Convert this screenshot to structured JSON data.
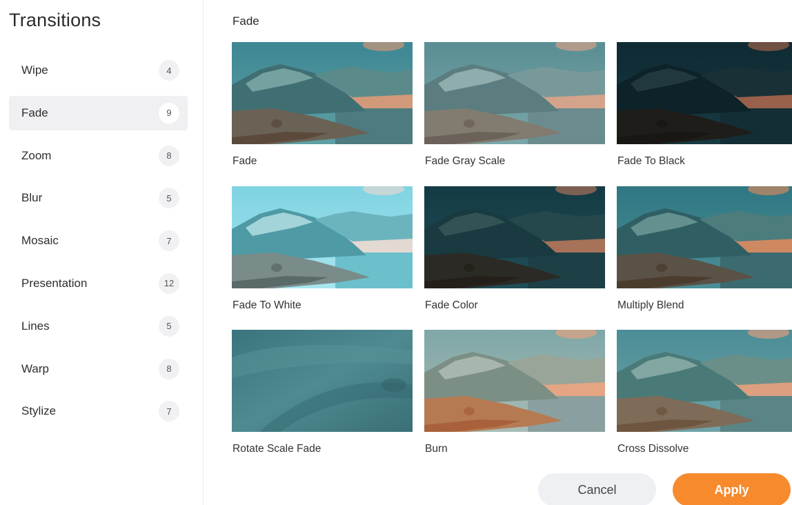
{
  "sidebar": {
    "title": "Transitions",
    "items": [
      {
        "label": "Wipe",
        "count": "4"
      },
      {
        "label": "Fade",
        "count": "9"
      },
      {
        "label": "Zoom",
        "count": "8"
      },
      {
        "label": "Blur",
        "count": "5"
      },
      {
        "label": "Mosaic",
        "count": "7"
      },
      {
        "label": "Presentation",
        "count": "12"
      },
      {
        "label": "Lines",
        "count": "5"
      },
      {
        "label": "Warp",
        "count": "8"
      },
      {
        "label": "Stylize",
        "count": "7"
      }
    ],
    "active_item": "Fade"
  },
  "main": {
    "section_title": "Fade",
    "thumbnails": [
      {
        "label": "Fade"
      },
      {
        "label": "Fade Gray Scale"
      },
      {
        "label": "Fade To Black"
      },
      {
        "label": "Fade To White"
      },
      {
        "label": "Fade Color"
      },
      {
        "label": "Multiply Blend"
      },
      {
        "label": "Rotate Scale Fade"
      },
      {
        "label": "Burn"
      },
      {
        "label": "Cross Dissolve"
      }
    ]
  },
  "footer": {
    "cancel_label": "Cancel",
    "apply_label": "Apply"
  },
  "colors": {
    "accent": "#f78a2c",
    "active_bg": "#f0f0f2"
  }
}
